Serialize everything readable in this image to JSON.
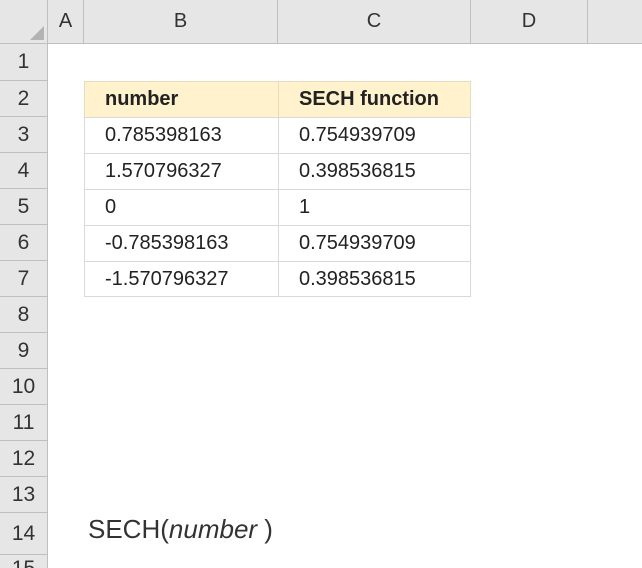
{
  "columns": [
    "A",
    "B",
    "C",
    "D",
    ""
  ],
  "rows": [
    "1",
    "2",
    "3",
    "4",
    "5",
    "6",
    "7",
    "8",
    "9",
    "10",
    "11",
    "12",
    "13",
    "14",
    "15"
  ],
  "table": {
    "headers": [
      "number",
      "SECH function"
    ],
    "rows": [
      [
        "0.785398163",
        "0.754939709"
      ],
      [
        "1.570796327",
        "0.398536815"
      ],
      [
        "0",
        "1"
      ],
      [
        "-0.785398163",
        "0.754939709"
      ],
      [
        "-1.570796327",
        "0.398536815"
      ]
    ]
  },
  "syntax": {
    "func": "SECH(",
    "arg": "number",
    "close": " )"
  }
}
